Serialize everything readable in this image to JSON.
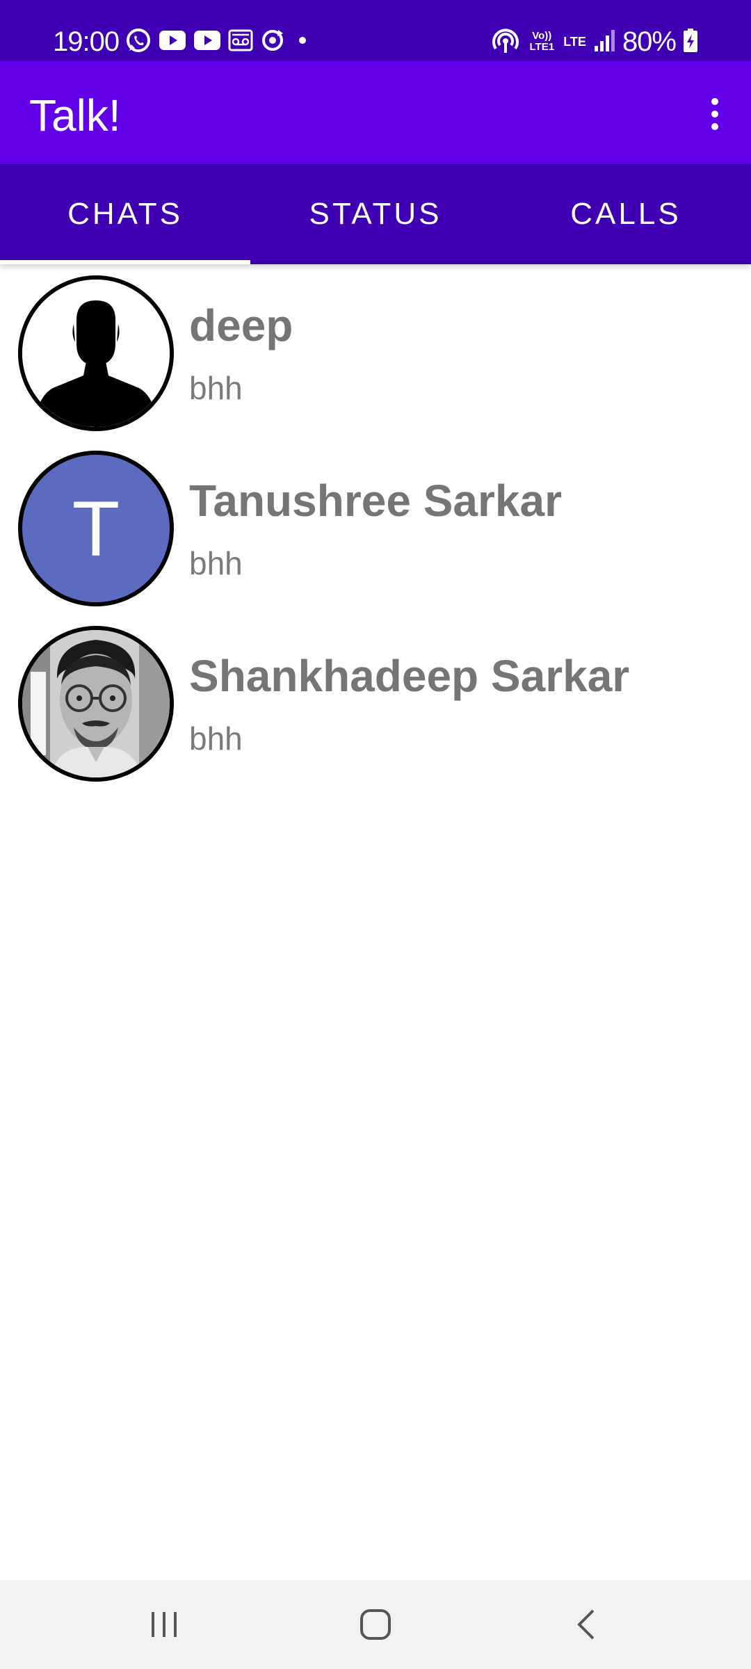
{
  "status_bar": {
    "time": "19:00",
    "battery": "80%",
    "left_icons": [
      "whatsapp-icon",
      "youtube-icon",
      "youtube-icon",
      "voicemail-icon",
      "sync-icon",
      "dot-icon"
    ],
    "right_icons": [
      "hotspot-icon",
      "volte-icon",
      "lte-icon",
      "signal-icon",
      "battery-charging-icon"
    ],
    "volte_label": "Vo)) LTE1",
    "lte_label": "LTE"
  },
  "app_bar": {
    "title": "Talk!",
    "menu_icon": "more-vert-icon"
  },
  "tabs": [
    {
      "label": "CHATS",
      "active": true
    },
    {
      "label": "STATUS",
      "active": false
    },
    {
      "label": "CALLS",
      "active": false
    }
  ],
  "chats": [
    {
      "name": "deep",
      "last_message": "bhh",
      "avatar": "default-person-icon"
    },
    {
      "name": "Tanushree Sarkar",
      "last_message": "bhh",
      "avatar_letter": "T",
      "avatar_color": "#5c6bc0"
    },
    {
      "name": "Shankhadeep Sarkar",
      "last_message": "bhh",
      "avatar": "profile-photo"
    }
  ],
  "colors": {
    "status_bar": "#3f00b3",
    "app_bar": "#6200ea",
    "tab_bar": "#3f00b3",
    "name_text": "#757575",
    "nav_bar": "#f2f2f2"
  },
  "nav_bar": {
    "buttons": [
      "recent-apps-icon",
      "home-icon",
      "back-icon"
    ]
  }
}
